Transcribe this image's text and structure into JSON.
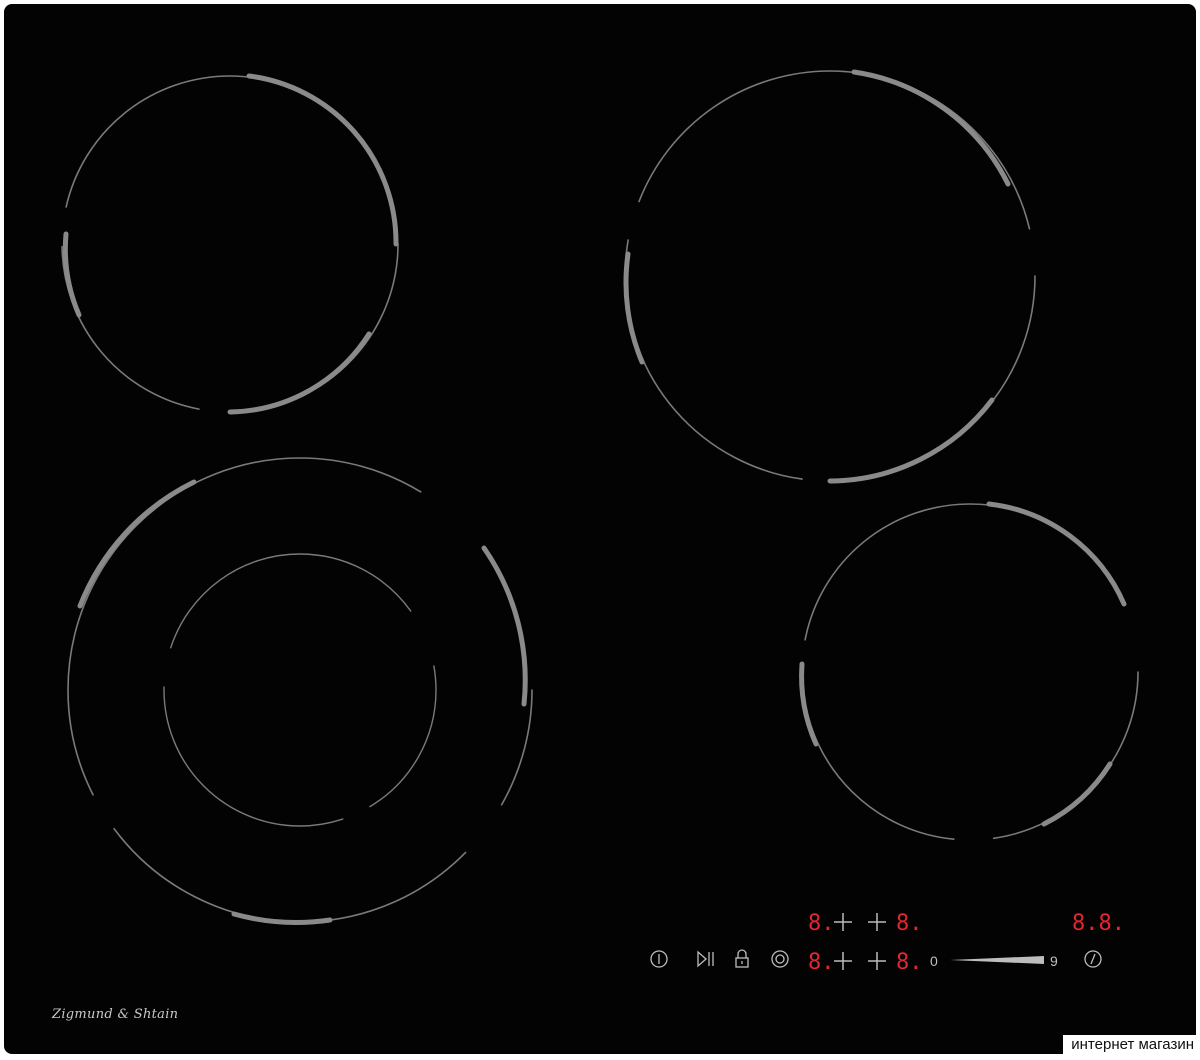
{
  "brand": {
    "name": "Zigmund & Shtain"
  },
  "watermark": {
    "text": "интернет магазин"
  },
  "control_panel": {
    "zone_displays_top": [
      "8.",
      "8."
    ],
    "zone_displays_bottom": [
      "8.",
      "8."
    ],
    "timer_display": "8.8.",
    "slider": {
      "min_label": "0",
      "max_label": "9"
    },
    "icons": [
      "power-icon",
      "play-pause-icon",
      "lock-icon",
      "zone-select-icon",
      "timer-icon"
    ],
    "display_color": "#e3262f"
  },
  "cooking_zones": [
    {
      "name": "rear-left-zone"
    },
    {
      "name": "front-left-dual-zone"
    },
    {
      "name": "rear-right-zone"
    },
    {
      "name": "front-right-zone"
    }
  ]
}
